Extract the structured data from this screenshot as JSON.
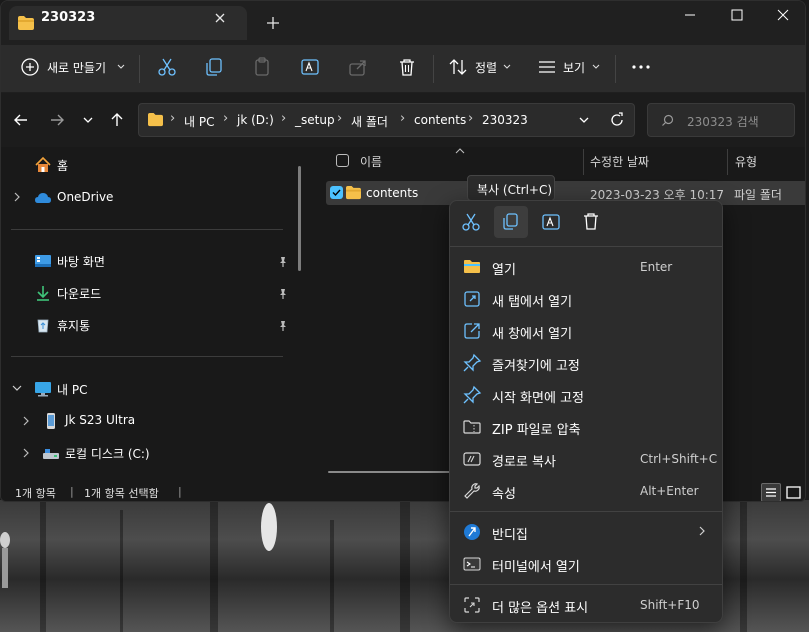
{
  "window": {
    "tab_title": "230323"
  },
  "toolbar": {
    "new_label": "새로 만들기",
    "sort_label": "정렬",
    "view_label": "보기"
  },
  "address": {
    "crumbs": [
      "내 PC",
      "jk (D:)",
      "_setup",
      "새 폴더",
      "contents",
      "230323"
    ],
    "search_placeholder": "230323 검색"
  },
  "sidebar": {
    "items": [
      {
        "label": "홈"
      },
      {
        "label": "OneDrive"
      },
      {
        "label": "바탕 화면"
      },
      {
        "label": "다운로드"
      },
      {
        "label": "휴지통"
      },
      {
        "label": "내 PC"
      },
      {
        "label": "Jk S23 Ultra"
      },
      {
        "label": "로컬 디스크 (C:)"
      }
    ]
  },
  "filelist": {
    "columns": [
      "이름",
      "수정한 날짜",
      "유형"
    ],
    "rows": [
      {
        "name": "contents",
        "modified": "2023-03-23 오후 10:17",
        "type": "파일 폴더"
      }
    ]
  },
  "status": {
    "count": "1개 항목",
    "selected": "1개 항목 선택함"
  },
  "tooltip": {
    "text": "복사 (Ctrl+C)"
  },
  "menu": {
    "items": [
      {
        "label": "열기",
        "accel": "Enter"
      },
      {
        "label": "새 탭에서 열기",
        "accel": ""
      },
      {
        "label": "새 창에서 열기",
        "accel": ""
      },
      {
        "label": "즐겨찾기에 고정",
        "accel": ""
      },
      {
        "label": "시작 화면에 고정",
        "accel": ""
      },
      {
        "label": "ZIP 파일로 압축",
        "accel": ""
      },
      {
        "label": "경로로 복사",
        "accel": "Ctrl+Shift+C"
      },
      {
        "label": "속성",
        "accel": "Alt+Enter"
      },
      {
        "label": "반디집",
        "accel": ""
      },
      {
        "label": "터미널에서 열기",
        "accel": ""
      },
      {
        "label": "더 많은 옵션 표시",
        "accel": "Shift+F10"
      }
    ]
  },
  "colors": {
    "accent": "#4cc2ff",
    "folder": "#f5c04a",
    "menu_bg": "#2c2c2c",
    "window_bg": "#191919"
  }
}
